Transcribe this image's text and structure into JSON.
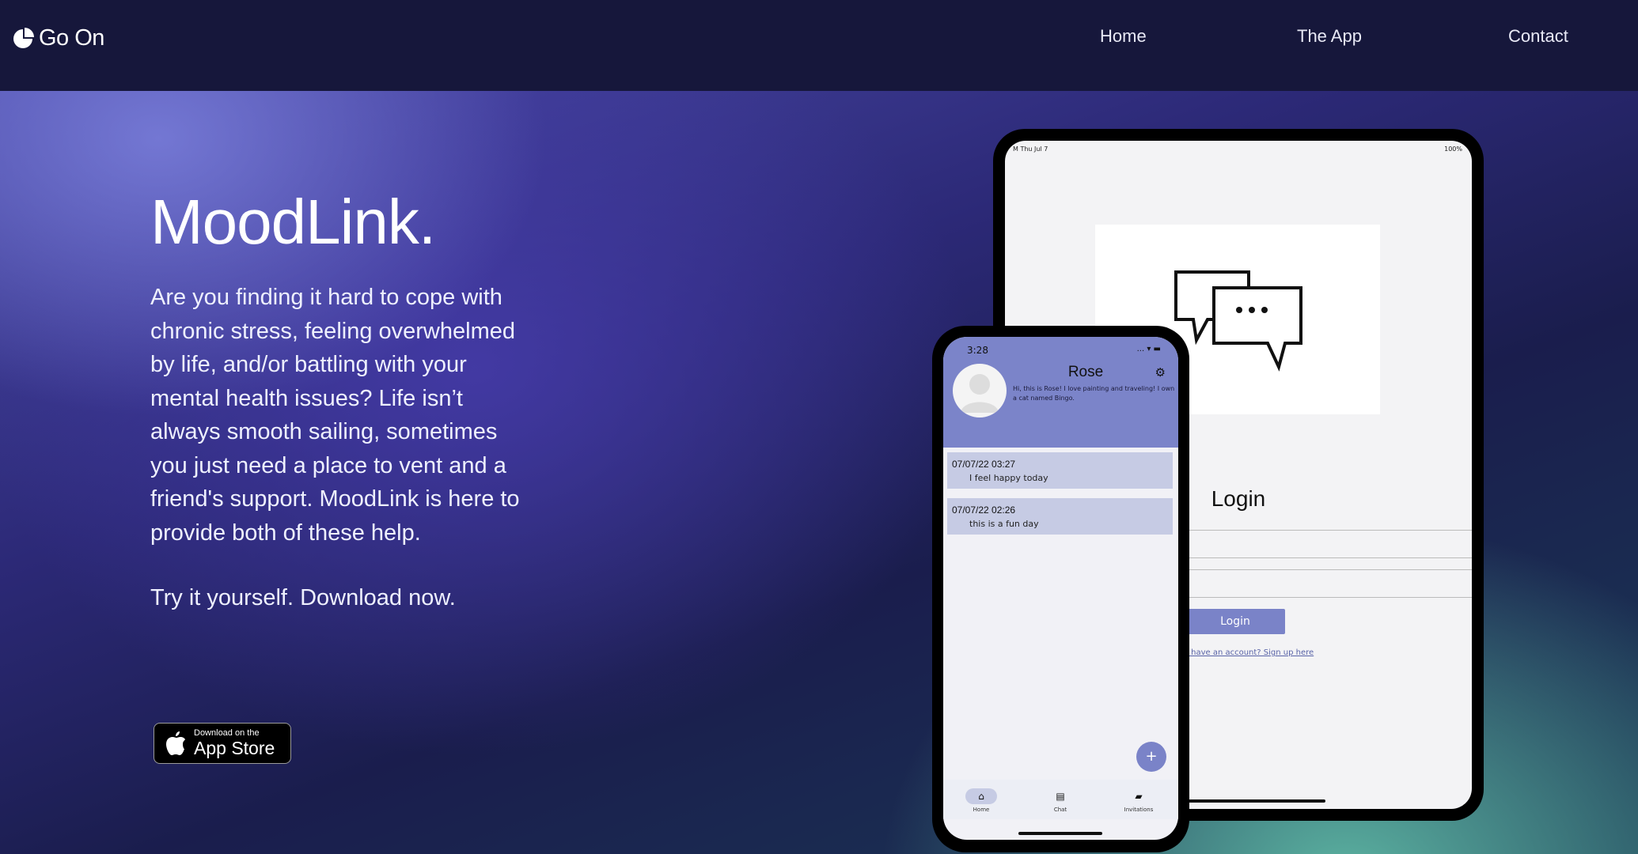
{
  "nav": {
    "logo_text": "Go On",
    "links": [
      {
        "label": "Home"
      },
      {
        "label": "The App"
      },
      {
        "label": "Contact"
      }
    ]
  },
  "hero": {
    "title": "MoodLink.",
    "body": "Are you finding it hard to cope with chronic stress, feeling overwhelmed by life, and/or battling with your mental health issues? Life isn’t always smooth sailing, sometimes you just need a place to vent and a friend's support. MoodLink is here to provide both of these help.",
    "cta": "Try it yourself. Download now.",
    "appstore": {
      "small": "Download on the",
      "big": "App Store"
    }
  },
  "tablet": {
    "status_left": "M   Thu Jul 7",
    "status_right": "100%",
    "login_title": "Login",
    "login_button": "Login",
    "signup_link": "t have an account? Sign up here"
  },
  "phone": {
    "time": "3:28",
    "status": "... ▾ ▬",
    "profile_name": "Rose",
    "profile_bio": "Hi, this is Rose! I love painting and traveling! I own a cat named Bingo.",
    "entries": [
      {
        "date": "07/07/22 03:27",
        "message": "I feel happy today"
      },
      {
        "date": "07/07/22 02:26",
        "message": "this is a fun day"
      }
    ],
    "fab": "+",
    "tabs": [
      {
        "label": "Home",
        "icon": "home-icon"
      },
      {
        "label": "Chat",
        "icon": "chat-icon"
      },
      {
        "label": "Invitations",
        "icon": "invitations-icon"
      }
    ]
  }
}
